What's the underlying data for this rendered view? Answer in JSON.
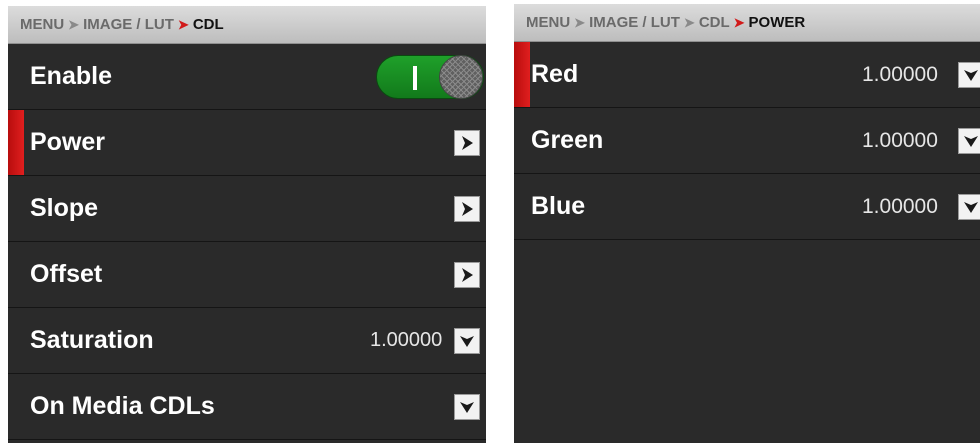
{
  "left": {
    "breadcrumb": {
      "menu": "MENU",
      "image_lut": "IMAGE / LUT",
      "current": "CDL"
    },
    "enable": {
      "label": "Enable",
      "state": "on"
    },
    "power": {
      "label": "Power",
      "icon": "chevron-right-icon"
    },
    "slope": {
      "label": "Slope",
      "icon": "chevron-right-icon"
    },
    "offset": {
      "label": "Offset",
      "icon": "chevron-right-icon"
    },
    "saturation": {
      "label": "Saturation",
      "value": "1.00000",
      "icon": "chevron-down-icon"
    },
    "on_media": {
      "label": "On Media CDLs",
      "icon": "chevron-down-icon"
    }
  },
  "right": {
    "breadcrumb": {
      "menu": "MENU",
      "image_lut": "IMAGE / LUT",
      "cdl": "CDL",
      "current": "POWER"
    },
    "red": {
      "label": "Red",
      "value": "1.00000",
      "icon": "chevron-down-icon"
    },
    "green": {
      "label": "Green",
      "value": "1.00000",
      "icon": "chevron-down-icon"
    },
    "blue": {
      "label": "Blue",
      "value": "1.00000",
      "icon": "chevron-down-icon"
    }
  },
  "colors": {
    "selection": "#d11a1a",
    "toggle_on": "#1b9325",
    "panel_bg": "#2a2a2a"
  }
}
